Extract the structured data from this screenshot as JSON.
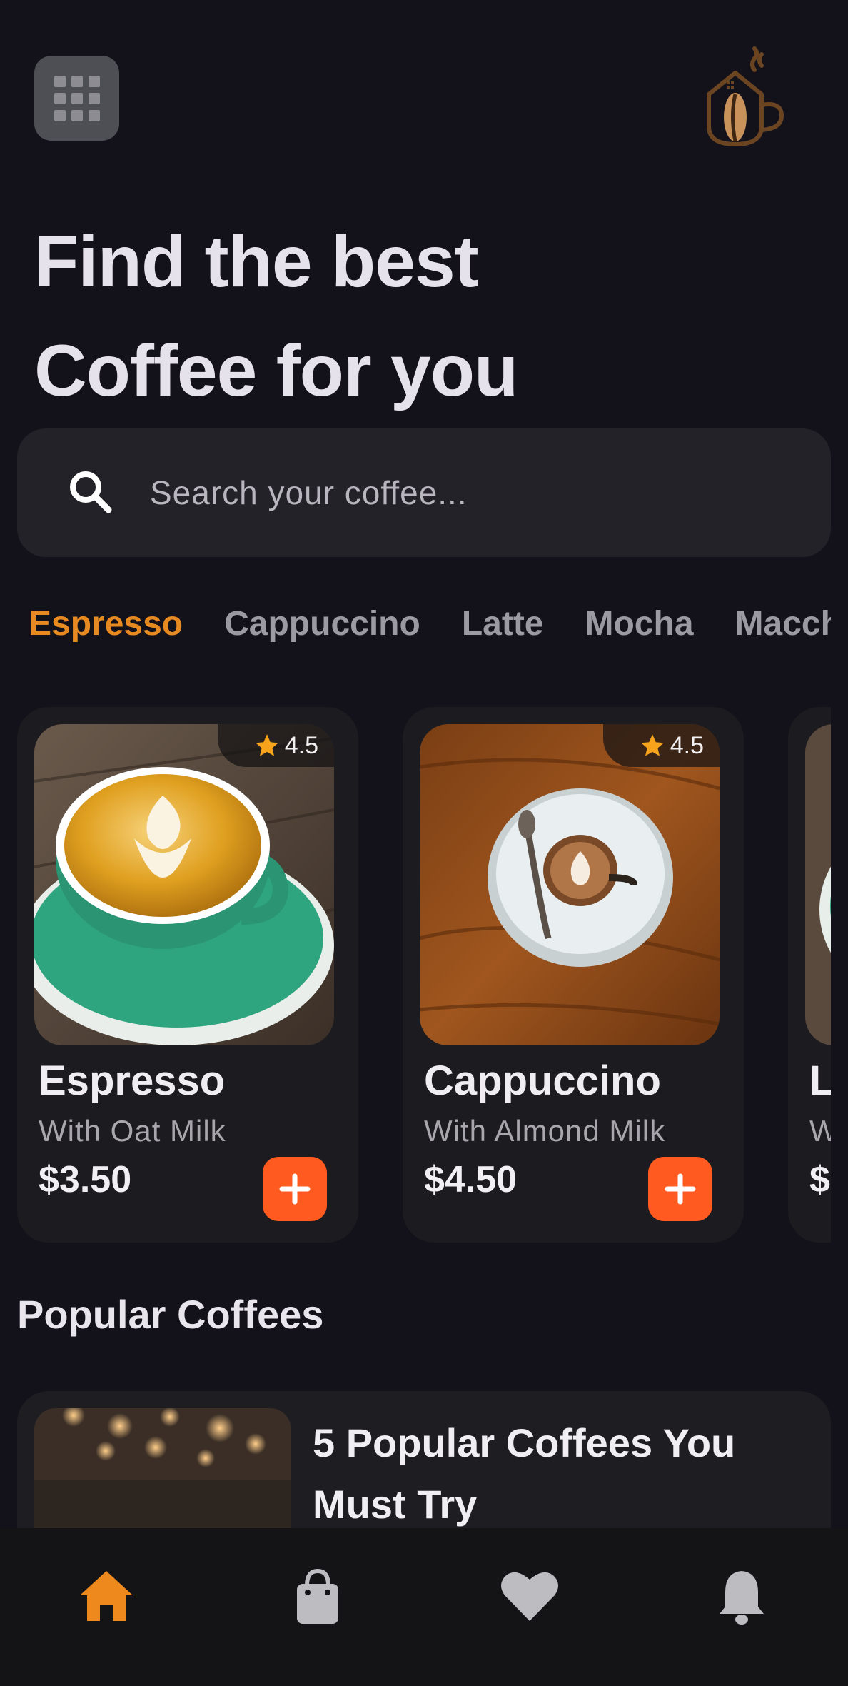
{
  "header": {
    "menu_icon": "grid-icon",
    "logo_icon": "coffee-cup-logo-icon"
  },
  "headline": {
    "line1": "Find the best",
    "line2": "Coffee for you"
  },
  "search": {
    "icon": "search-icon",
    "placeholder": "Search your coffee..."
  },
  "categories": {
    "active_index": 0,
    "items": [
      "Espresso",
      "Cappuccino",
      "Latte",
      "Mocha",
      "Macchi"
    ]
  },
  "products": [
    {
      "name": "Espresso",
      "subtitle": "With Oat Milk",
      "price": "$3.50",
      "rating": "4.5"
    },
    {
      "name": "Cappuccino",
      "subtitle": "With Almond Milk",
      "price": "$4.50",
      "rating": "4.5"
    },
    {
      "name": "L",
      "subtitle": "W",
      "price": "$",
      "rating": ""
    }
  ],
  "popular": {
    "section_title": "Popular Coffees",
    "item_title": "5 Popular Coffees You Must Try"
  },
  "bottom_nav": {
    "items": [
      "home-icon",
      "shopping-bag-icon",
      "heart-icon",
      "bell-icon"
    ],
    "active_index": 0
  },
  "colors": {
    "background": "#13121a",
    "accent": "#e88a22",
    "add_button": "#ff5a1f",
    "card": "#1c1b20"
  }
}
